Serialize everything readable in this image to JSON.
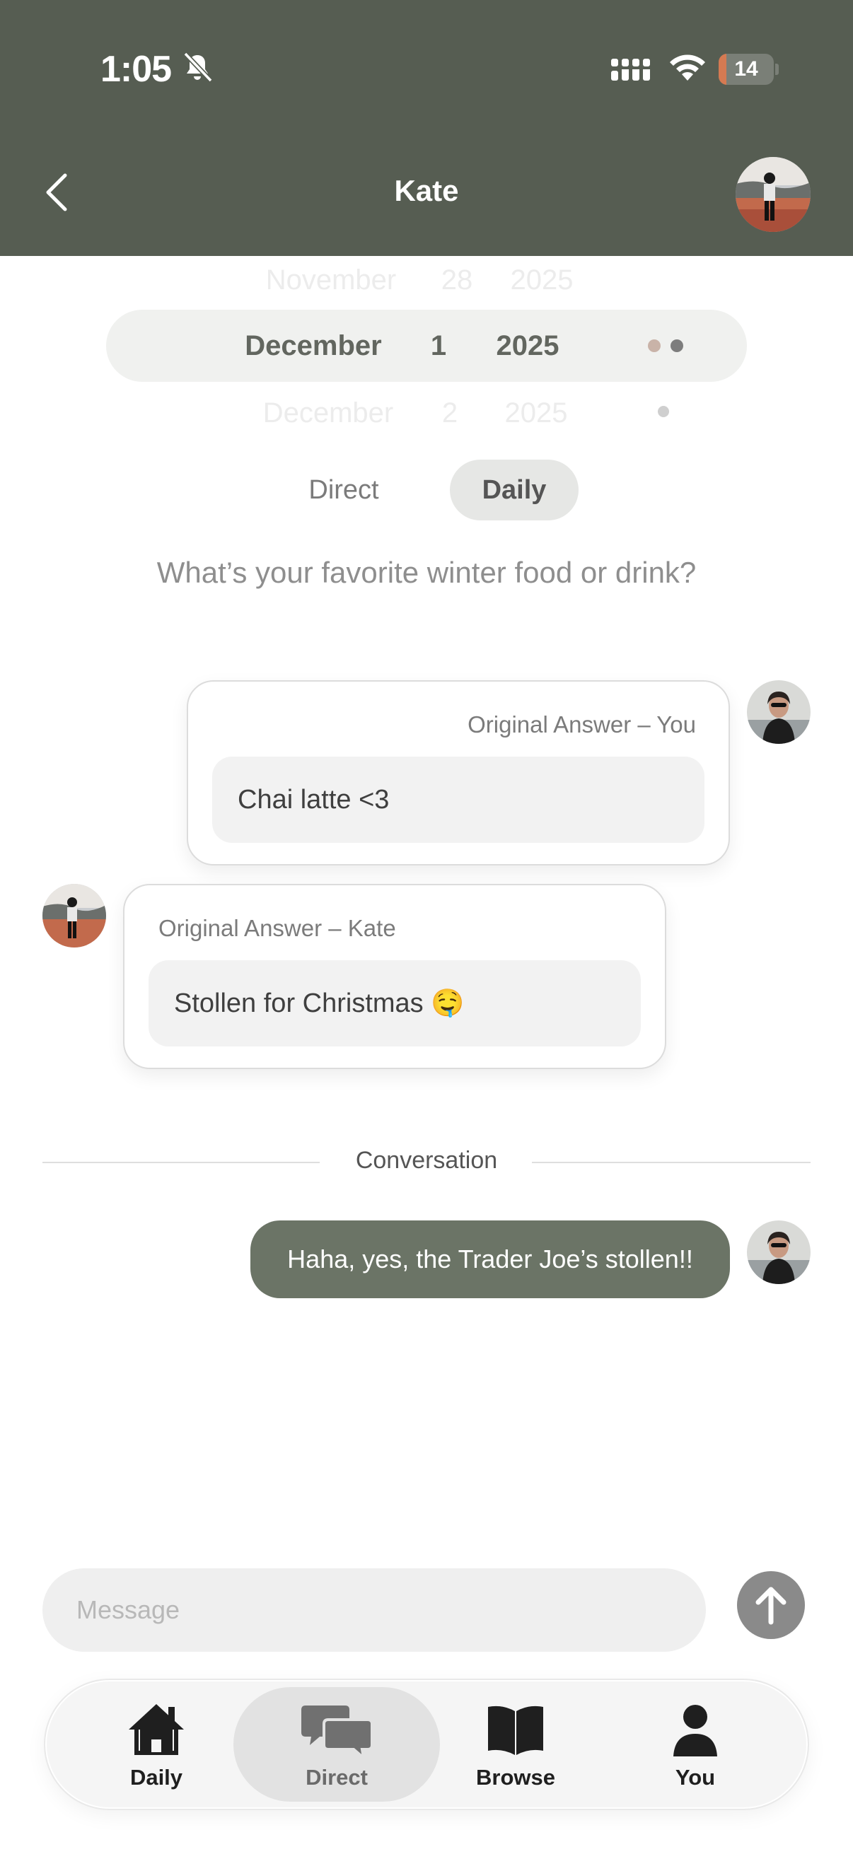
{
  "status_bar": {
    "time": "1:05",
    "battery": "14",
    "battery_fraction": 0.14
  },
  "header": {
    "title": "Kate"
  },
  "date_picker": {
    "prev": {
      "month": "November",
      "day": "28",
      "year": "2025"
    },
    "selected": {
      "month": "December",
      "day": "1",
      "year": "2025"
    },
    "next": {
      "month": "December",
      "day": "2",
      "year": "2025"
    }
  },
  "segmented": {
    "direct_label": "Direct",
    "daily_label": "Daily",
    "active": "Daily"
  },
  "question": "What’s your favorite winter food or drink?",
  "answers": {
    "you": {
      "label": "Original Answer – You",
      "text": "Chai latte <3"
    },
    "kate": {
      "label": "Original Answer – Kate",
      "text": "Stollen for Christmas 🤤"
    }
  },
  "conversation": {
    "divider_label": "Conversation",
    "messages": [
      {
        "from": "You",
        "text": "Haha, yes, the Trader Joe’s stollen!!"
      }
    ]
  },
  "composer": {
    "placeholder": "Message"
  },
  "tab_bar": {
    "items": [
      {
        "label": "Daily",
        "icon": "house-icon"
      },
      {
        "label": "Direct",
        "icon": "chat-bubbles-icon"
      },
      {
        "label": "Browse",
        "icon": "open-book-icon"
      },
      {
        "label": "You",
        "icon": "person-icon"
      }
    ],
    "active": "Direct"
  },
  "colors": {
    "header_bg": "#565d52",
    "bubble_bg": "#6b7466",
    "battery_fill": "#d57a52",
    "picker_dot_1": "#c9b3a8",
    "picker_dot_2": "#7d7d7d",
    "picker_dot_3": "#cfcfcf"
  }
}
